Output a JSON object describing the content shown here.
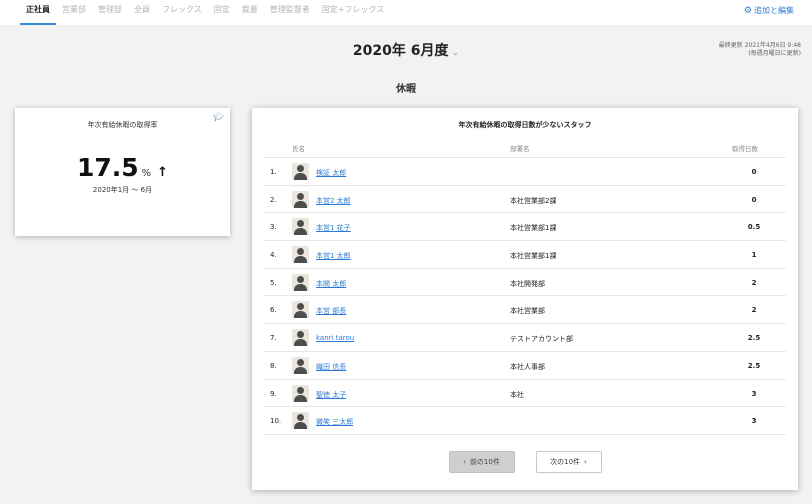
{
  "tabs": [
    "正社員",
    "営業部",
    "管理部",
    "全員",
    "フレックス",
    "固定",
    "裁量",
    "管理監督者",
    "固定+フレックス"
  ],
  "active_tab": 0,
  "add_edit_label": "追加と編集",
  "period": "2020年 6月度",
  "updated_line1": "最終更新 2021年4月6日 9:48",
  "updated_line2": "(毎週月曜日に更新)",
  "section_title": "休暇",
  "rate_card": {
    "title": "年次有給休暇の取得率",
    "value": "17.5",
    "unit": "%",
    "trend_arrow": "↑",
    "range": "2020年1月 〜 6月"
  },
  "staff_card": {
    "title": "年次有給休暇の取得日数が少ないスタッフ",
    "col_name": "氏名",
    "col_dept": "部署名",
    "col_days": "取得日数",
    "rows": [
      {
        "no": "1.",
        "name": "検証 太郎",
        "dept": "",
        "days": "0"
      },
      {
        "no": "2.",
        "name": "本営2 太郎",
        "dept": "本社営業部2課",
        "days": "0"
      },
      {
        "no": "3.",
        "name": "本営1 花子",
        "dept": "本社営業部1課",
        "days": "0.5"
      },
      {
        "no": "4.",
        "name": "本営1 太郎",
        "dept": "本社営業部1課",
        "days": "1"
      },
      {
        "no": "5.",
        "name": "本開 太郎",
        "dept": "本社開発部",
        "days": "2"
      },
      {
        "no": "6.",
        "name": "本営 部長",
        "dept": "本社営業部",
        "days": "2"
      },
      {
        "no": "7.",
        "name": "kanri tarou",
        "dept": "テストアカウント部",
        "days": "2.5"
      },
      {
        "no": "8.",
        "name": "織田 信長",
        "dept": "本社人事部",
        "days": "2.5"
      },
      {
        "no": "9.",
        "name": "聖徳 太子",
        "dept": "本社",
        "days": "3"
      },
      {
        "no": "10.",
        "name": "微笑 三太郎",
        "dept": "",
        "days": "3"
      }
    ],
    "prev_label": "前の10件",
    "next_label": "次の10件"
  }
}
